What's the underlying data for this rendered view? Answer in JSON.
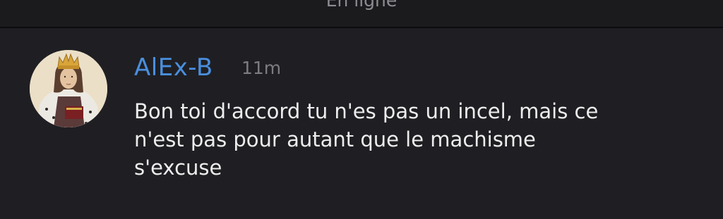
{
  "header": {
    "status": "En ligne"
  },
  "message": {
    "author": "AlEx-B",
    "time": "11m",
    "lines": [
      "Bon toi d'accord tu n'es pas un incel, mais ce",
      "n'est pas pour autant que le machisme",
      "s'excuse"
    ]
  },
  "colors": {
    "author": "#4a8fde",
    "timestamp": "#7c7c82",
    "text": "#ededed",
    "background": "#1f1f23"
  }
}
